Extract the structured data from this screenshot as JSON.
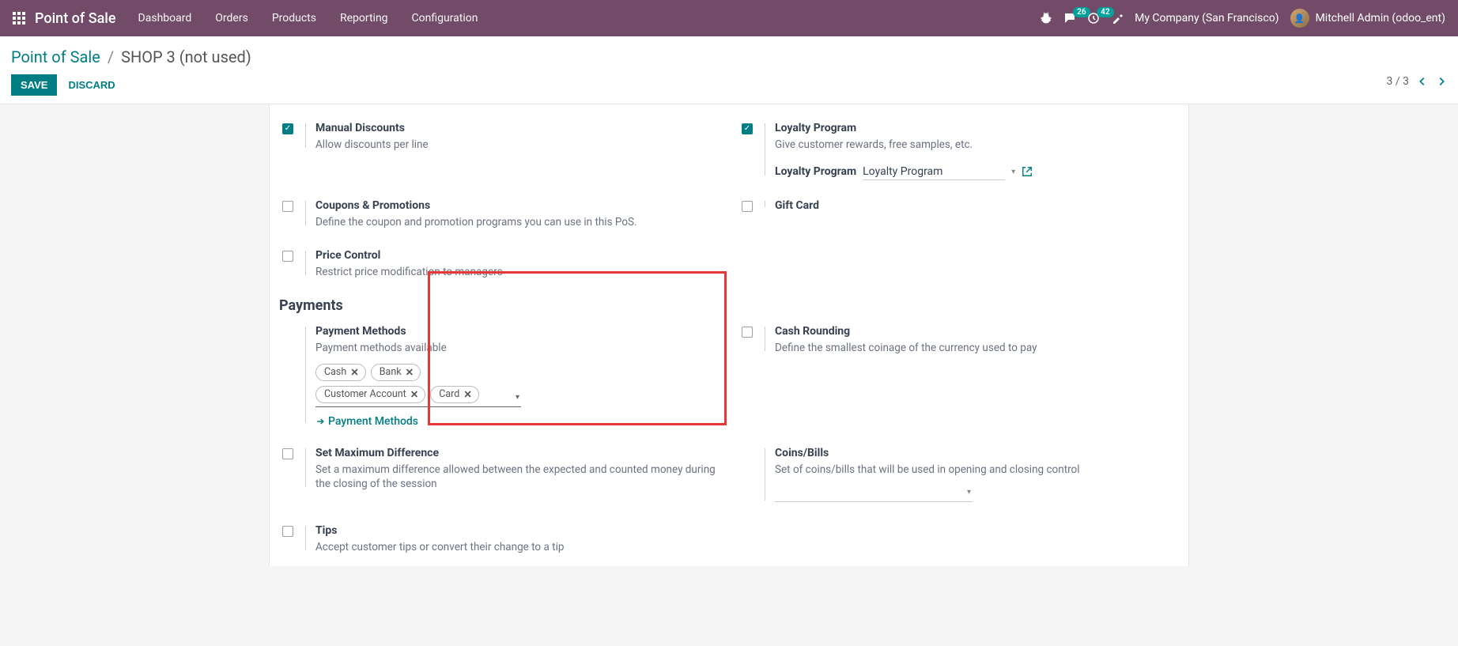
{
  "topbar": {
    "brand": "Point of Sale",
    "nav": [
      "Dashboard",
      "Orders",
      "Products",
      "Reporting",
      "Configuration"
    ],
    "messages_count": "26",
    "activities_count": "42",
    "company": "My Company (San Francisco)",
    "user": "Mitchell Admin (odoo_ent)"
  },
  "breadcrumb": {
    "root": "Point of Sale",
    "current": "SHOP 3 (not used)"
  },
  "actions": {
    "save": "SAVE",
    "discard": "DISCARD"
  },
  "pager": "3 / 3",
  "settings": {
    "manual_discounts": {
      "title": "Manual Discounts",
      "desc": "Allow discounts per line",
      "checked": true
    },
    "loyalty_program": {
      "title": "Loyalty Program",
      "desc": "Give customer rewards, free samples, etc.",
      "checked": true,
      "sub_label": "Loyalty Program",
      "sub_value": "Loyalty Program"
    },
    "coupons": {
      "title": "Coupons & Promotions",
      "desc": "Define the coupon and promotion programs you can use in this PoS.",
      "checked": false
    },
    "gift_card": {
      "title": "Gift Card",
      "desc": "",
      "checked": false
    },
    "price_control": {
      "title": "Price Control",
      "desc": "Restrict price modification to managers",
      "checked": false
    },
    "payments_section": "Payments",
    "payment_methods": {
      "title": "Payment Methods",
      "desc": "Payment methods available",
      "tags": [
        "Cash",
        "Bank",
        "Customer Account",
        "Card"
      ],
      "link": "Payment Methods"
    },
    "cash_rounding": {
      "title": "Cash Rounding",
      "desc": "Define the smallest coinage of the currency used to pay",
      "checked": false
    },
    "set_max_diff": {
      "title": "Set Maximum Difference",
      "desc": "Set a maximum difference allowed between the expected and counted money during the closing of the session",
      "checked": false
    },
    "coins_bills": {
      "title": "Coins/Bills",
      "desc": "Set of coins/bills that will be used in opening and closing control"
    },
    "tips": {
      "title": "Tips",
      "desc": "Accept customer tips or convert their change to a tip",
      "checked": false
    }
  }
}
